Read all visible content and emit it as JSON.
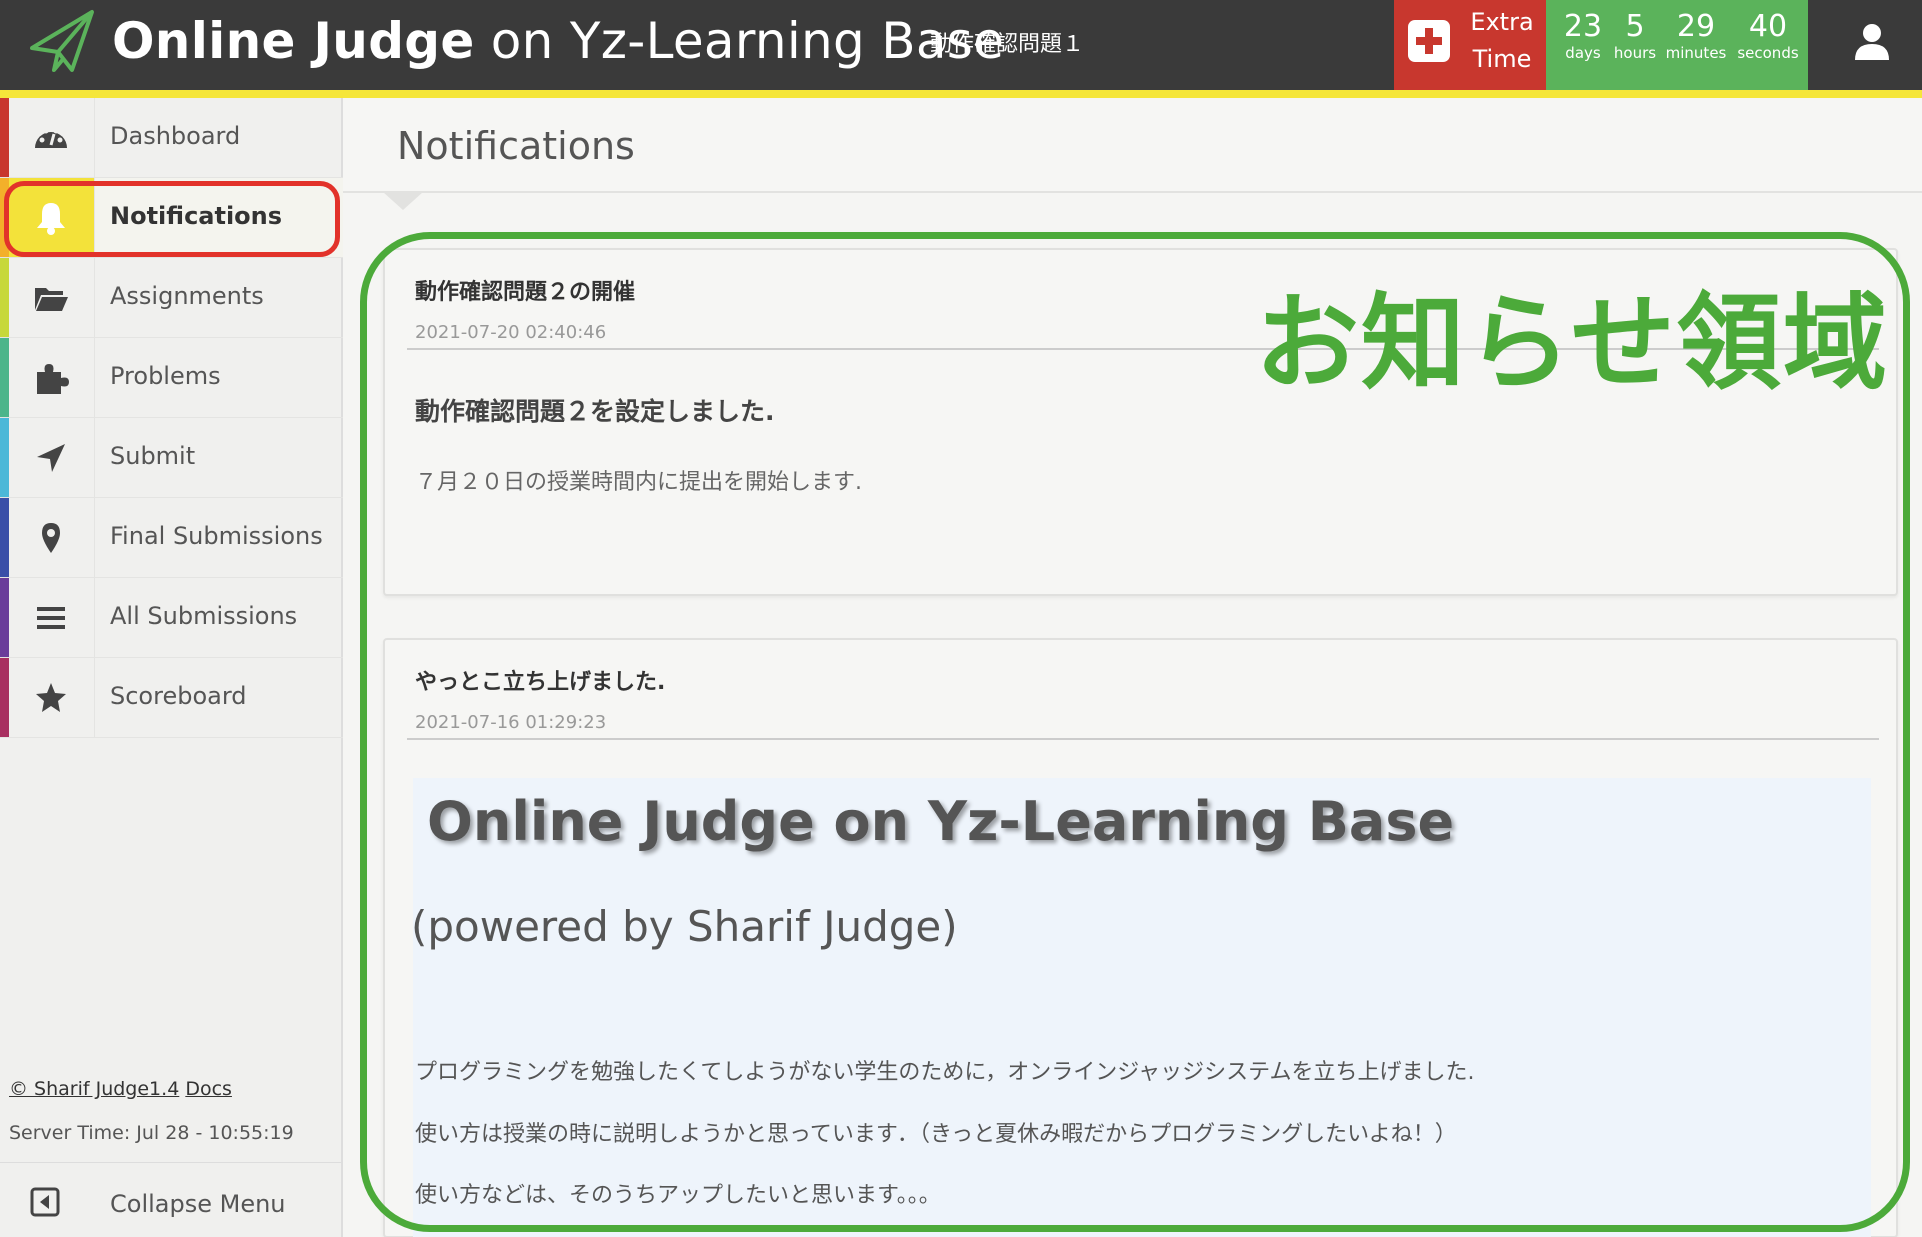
{
  "header": {
    "brand_bold": "Online Judge",
    "brand_rest": " on Yz-Learning Base",
    "assignment": "動作確認問題１",
    "extra_time": {
      "line1": "Extra",
      "line2": "Time"
    },
    "countdown": [
      {
        "num": "23",
        "unit": "days"
      },
      {
        "num": "5",
        "unit": "hours"
      },
      {
        "num": "29",
        "unit": "minutes"
      },
      {
        "num": "40",
        "unit": "seconds"
      }
    ],
    "colors": {
      "bar": "#3a3a3a",
      "stripe": "#f5e63a",
      "extra": "#c8372e",
      "countdown": "#5bb35b"
    }
  },
  "sidebar": {
    "items": [
      {
        "label": "Dashboard",
        "icon": "dashboard-icon",
        "color": "#c8372e"
      },
      {
        "label": "Notifications",
        "icon": "bell-icon",
        "color": "#f3b02a",
        "active": true
      },
      {
        "label": "Assignments",
        "icon": "folder-open-icon",
        "color": "#c7d83a"
      },
      {
        "label": "Problems",
        "icon": "puzzle-icon",
        "color": "#4cb58a"
      },
      {
        "label": "Submit",
        "icon": "send-icon",
        "color": "#4bb8d8"
      },
      {
        "label": "Final Submissions",
        "icon": "map-marker-icon",
        "color": "#3a4fa8"
      },
      {
        "label": "All Submissions",
        "icon": "list-icon",
        "color": "#6a3d9a"
      },
      {
        "label": "Scoreboard",
        "icon": "star-icon",
        "color": "#a83060"
      }
    ],
    "footer": {
      "copyright": "© Sharif Judge1.4",
      "docs": "Docs",
      "server_time": "Server Time: Jul 28 - 10:55:19"
    },
    "collapse_label": "Collapse Menu"
  },
  "main": {
    "title": "Notifications",
    "annotation_label": "お知らせ領域",
    "notifications": [
      {
        "title": "動作確認問題２の開催",
        "date": "2021-07-20 02:40:46",
        "body_heading": "動作確認問題２を設定しました.",
        "body_text": "７月２０日の授業時間内に提出を開始します."
      },
      {
        "title": "やっとこ立ち上げました.",
        "date": "2021-07-16 01:29:23",
        "h1": "Online Judge on Yz-Learning Base",
        "h2": "(powered by Sharif Judge)",
        "paragraphs": [
          "プログラミングを勉強したくてしようがない学生のために，オンラインジャッジシステムを立ち上げました.",
          "使い方は授業の時に説明しようかと思っています．（きっと夏休み暇だからプログラミングしたいよね！）",
          "使い方などは、そのうちアップしたいと思います。。。"
        ]
      }
    ]
  }
}
